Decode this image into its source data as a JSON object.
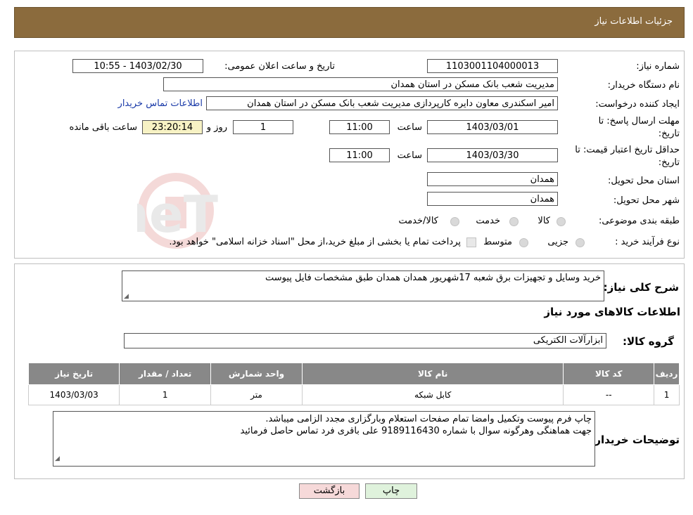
{
  "header": {
    "title": "جزئیات اطلاعات نیاز"
  },
  "watermark": {
    "text": "AriaTender.neT"
  },
  "form": {
    "need_number_label": "شماره نیاز:",
    "need_number": "1103001104000013",
    "announce_label": "تاریخ و ساعت اعلان عمومی:",
    "announce_value": "1403/02/30 - 10:55",
    "buyer_org_label": "نام دستگاه خریدار:",
    "buyer_org": "مدیریت شعب بانک مسکن در استان همدان",
    "creator_label": "ایجاد کننده درخواست:",
    "creator": "امیر اسکندری معاون دایره کارپردازی مدیریت شعب بانک مسکن در استان همدان",
    "contact_link": "اطلاعات تماس خریدار",
    "reply_deadline_label_1": "مهلت ارسال پاسخ: تا",
    "reply_deadline_label_2": "تاریخ:",
    "reply_date": "1403/03/01",
    "time_label": "ساعت",
    "reply_time": "11:00",
    "days_value": "1",
    "days_label": "روز و",
    "remaining_time": "23:20:14",
    "remaining_label": "ساعت باقی مانده",
    "min_price_label_1": "حداقل تاریخ اعتبار قیمت: تا",
    "min_price_label_2": "تاریخ:",
    "min_price_date": "1403/03/30",
    "min_price_time": "11:00",
    "province_label": "استان محل تحویل:",
    "province": "همدان",
    "city_label": "شهر محل تحویل:",
    "city": "همدان",
    "category_label": "طبقه بندی موضوعی:",
    "category_options": [
      "کالا",
      "خدمت",
      "کالا/خدمت"
    ],
    "process_label": "نوع فرآیند خرید :",
    "process_options": [
      "جزیی",
      "متوسط"
    ],
    "process_note": "پرداخت تمام یا بخشی از مبلغ خرید،از محل \"اسناد خزانه اسلامی\" خواهد بود."
  },
  "description": {
    "label": "شرح کلی نیاز:",
    "text": "خرید وسایل و تجهیزات برق شعبه 17شهریور همدان همدان طبق مشخصات فایل پیوست"
  },
  "items_section": {
    "title": "اطلاعات کالاهای مورد نیاز",
    "group_label": "گروه کالا:",
    "group_value": "ابزارآلات الکتریکی",
    "columns": [
      "ردیف",
      "کد کالا",
      "نام کالا",
      "واحد شمارش",
      "تعداد / مقدار",
      "تاریخ نیاز"
    ],
    "rows": [
      [
        "1",
        "--",
        "کابل شبکه",
        "متر",
        "1",
        "1403/03/03"
      ]
    ]
  },
  "buyer_notes": {
    "label": "توضیحات خریدار:",
    "line1": "چاپ فرم پیوست وتکمیل وامضا تمام صفحات استعلام وبارگزاری مجدد الزامی میباشد.",
    "line2": "جهت هماهنگی وهرگونه سوال با شماره 9189116430 علی باقری فرد تماس حاصل فرمائید"
  },
  "buttons": {
    "print": "چاپ",
    "back": "بازگشت"
  },
  "colors": {
    "header_bg": "#8b6b3d",
    "link": "#1a3aa8",
    "back_button_bg": "#f6d9d9",
    "print_button_bg": "#dff2dc"
  }
}
